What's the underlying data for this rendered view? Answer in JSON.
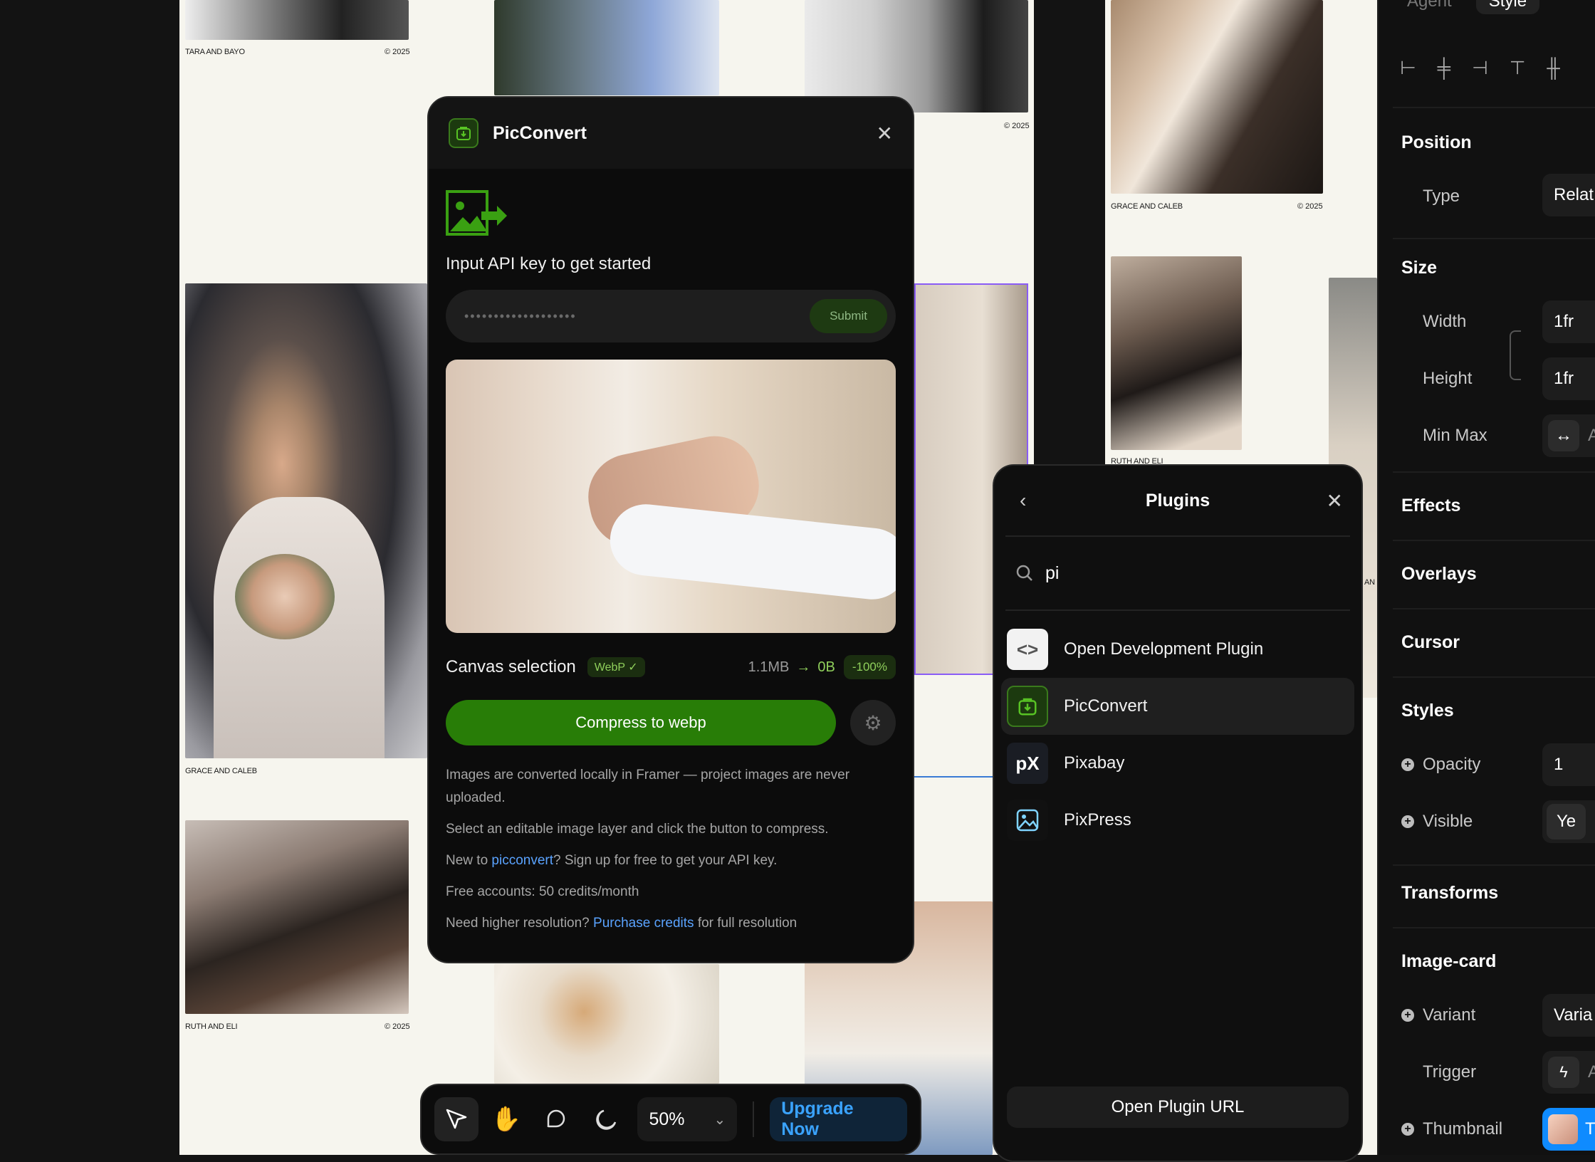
{
  "canvas": {
    "captions": [
      {
        "left": "TARA AND BAYO",
        "right": "© 2025"
      },
      {
        "right": "© 2025"
      },
      {
        "left": "GRACE AND CALEB",
        "right": "© 2025"
      },
      {
        "left": "GRACE AND CALEB"
      },
      {
        "left": "RUTH AND ELI",
        "right": "© 2025"
      },
      {
        "left": "RUTH AND ELI",
        "right": "© 2025"
      },
      {
        "left": "AN"
      }
    ]
  },
  "picconvert": {
    "title": "PicConvert",
    "prompt": "Input API key to get started",
    "api_key_masked": "•••••••••••••••••••",
    "submit_label": "Submit",
    "selection_label": "Canvas selection",
    "format_badge": "WebP ✓",
    "size_from": "1.1MB",
    "arrow": "→",
    "size_to": "0B",
    "reduction": "-100%",
    "compress_label": "Compress to webp",
    "info": {
      "line1": "Images are converted locally in Framer — project images are never uploaded.",
      "line2": "Select an editable image layer and click the button to compress.",
      "line3_pre": "New to ",
      "line3_link": "picconvert",
      "line3_post": "? Sign up for free to get your API key.",
      "line4": "Free accounts: 50 credits/month",
      "line5_pre": "Need higher resolution? ",
      "line5_link": "Purchase credits",
      "line5_post": " for full resolution"
    }
  },
  "plugins": {
    "title": "Plugins",
    "search_value": "pi",
    "items": [
      {
        "label": "Open Development Plugin",
        "icon": "code-icon"
      },
      {
        "label": "PicConvert",
        "icon": "picconvert-icon"
      },
      {
        "label": "Pixabay",
        "icon": "pixabay-icon",
        "glyph": "pX"
      },
      {
        "label": "PixPress",
        "icon": "pixpress-icon"
      }
    ],
    "open_url_label": "Open Plugin URL"
  },
  "properties": {
    "tabs": [
      "Agent",
      "Style"
    ],
    "position": {
      "title": "Position",
      "type_label": "Type",
      "type_value": "Relat"
    },
    "size": {
      "title": "Size",
      "width_label": "Width",
      "width_value": "1fr",
      "height_label": "Height",
      "height_value": "1fr",
      "minmax_label": "Min Max",
      "minmax_value": "A"
    },
    "effects": "Effects",
    "overlays": "Overlays",
    "cursor": "Cursor",
    "styles": {
      "title": "Styles",
      "opacity_label": "Opacity",
      "opacity_value": "1",
      "visible_label": "Visible",
      "visible_value": "Ye"
    },
    "transforms": "Transforms",
    "image_card": {
      "title": "Image-card",
      "variant_label": "Variant",
      "variant_value": "Varia",
      "trigger_label": "Trigger",
      "trigger_value": "A",
      "thumbnail_label": "Thumbnail",
      "thumbnail_value": "T"
    }
  },
  "toolbar": {
    "zoom": "50%",
    "upgrade_label": "Upgrade Now"
  },
  "colors": {
    "accent_green": "#287d07",
    "link_blue": "#5aa3ff",
    "upgrade_blue": "#3aa3ff"
  }
}
